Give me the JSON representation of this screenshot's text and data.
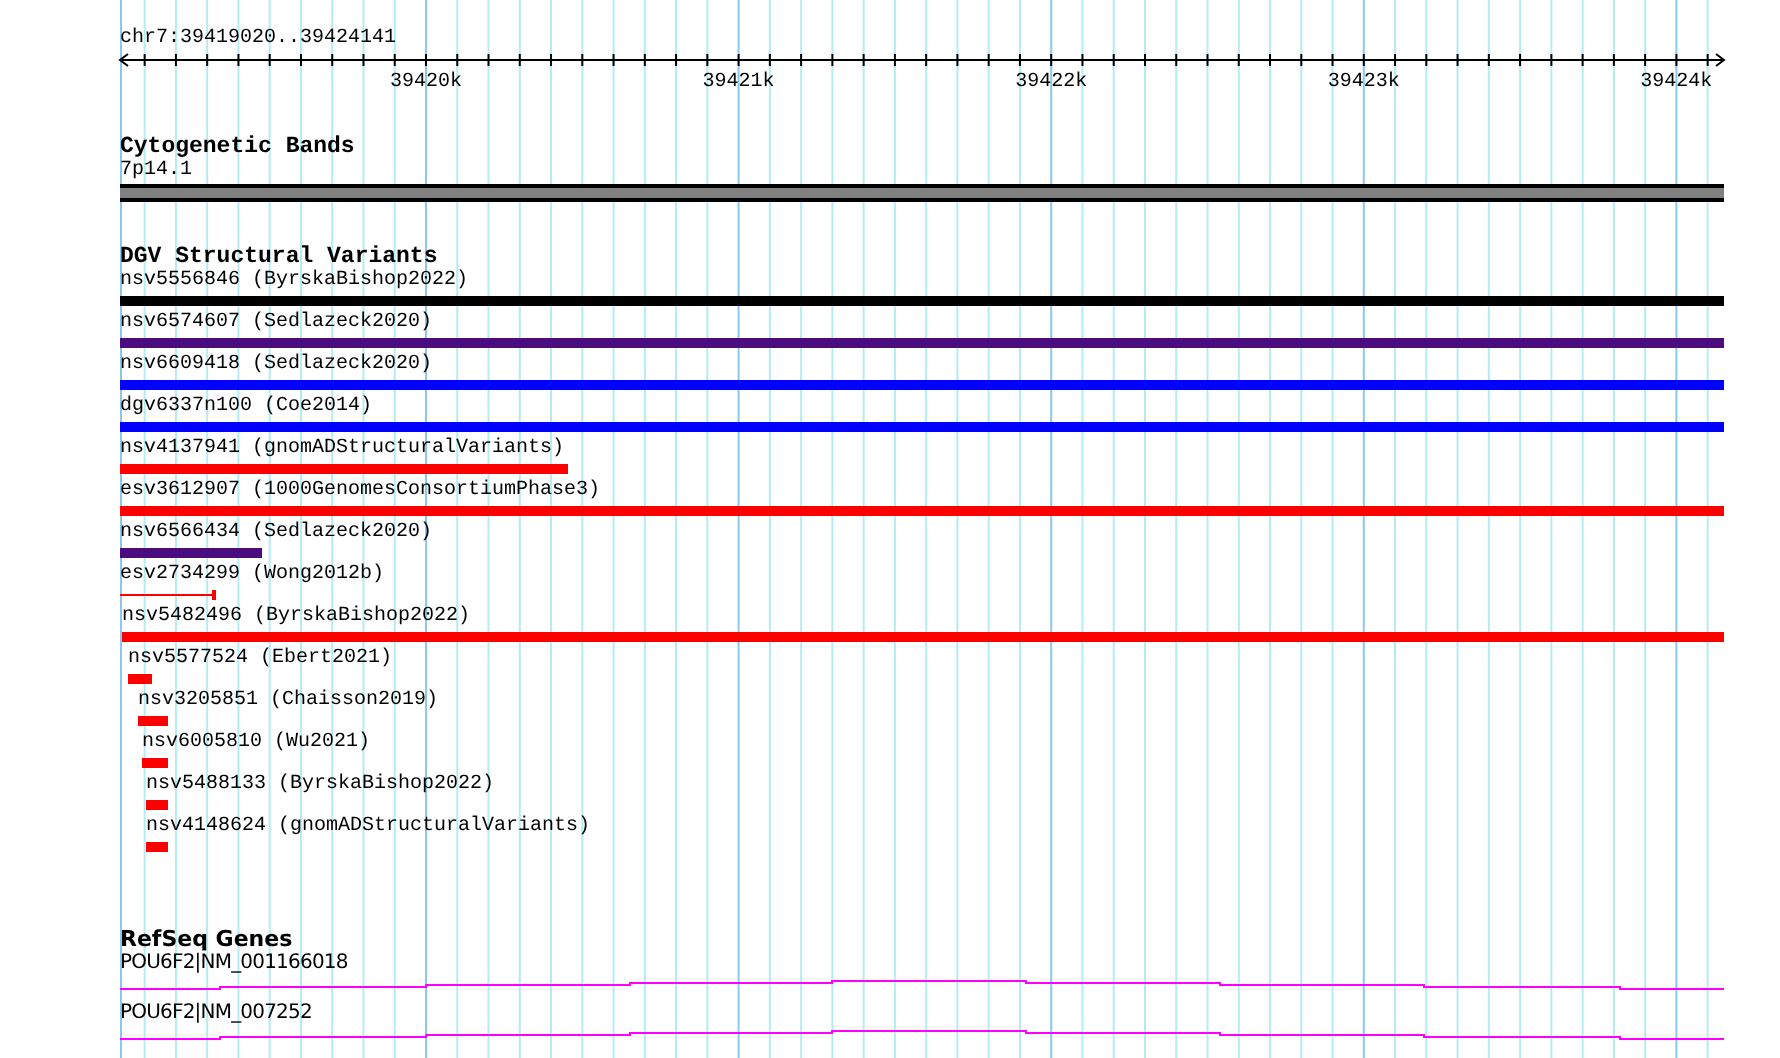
{
  "ruler": {
    "region": "chr7:39419020..39424141",
    "ticks": [
      "39420k",
      "39421k",
      "39422k",
      "39423k",
      "39424k"
    ]
  },
  "tracks": [
    {
      "kind": "cytoband",
      "title": "Cytogenetic Bands",
      "features": [
        {
          "label": "7p14.1"
        }
      ]
    },
    {
      "kind": "variants",
      "title": "DGV Structural Variants",
      "features": [
        {
          "label": "nsv5556846 (ByrskaBishop2022)",
          "kind": "bar",
          "color": "#000000"
        },
        {
          "label": "nsv6574607 (Sedlazeck2020)",
          "kind": "bar",
          "color": "#4b0c80"
        },
        {
          "label": "nsv6609418 (Sedlazeck2020)",
          "kind": "bar",
          "color": "#0000ff"
        },
        {
          "label": "dgv6337n100 (Coe2014)",
          "kind": "bar",
          "color": "#0000ff"
        },
        {
          "label": "nsv4137941 (gnomADStructuralVariants)",
          "kind": "bar",
          "color": "#ff0000"
        },
        {
          "label": "esv3612907 (1000GenomesConsortiumPhase3)",
          "kind": "bar",
          "color": "#ff0000"
        },
        {
          "label": "nsv6566434 (Sedlazeck2020)",
          "kind": "bar",
          "color": "#4b0c80"
        },
        {
          "label": "esv2734299 (Wong2012b)",
          "kind": "line",
          "color": "#ff0000"
        },
        {
          "label": "nsv5482496 (ByrskaBishop2022)",
          "kind": "bar",
          "color": "#ff0000"
        },
        {
          "label": "nsv5577524 (Ebert2021)",
          "kind": "bar",
          "color": "#ff0000"
        },
        {
          "label": "nsv3205851 (Chaisson2019)",
          "kind": "bar",
          "color": "#ff0000"
        },
        {
          "label": "nsv6005810 (Wu2021)",
          "kind": "bar",
          "color": "#ff0000"
        },
        {
          "label": "nsv5488133 (ByrskaBishop2022)",
          "kind": "bar",
          "color": "#ff0000"
        },
        {
          "label": "nsv4148624 (gnomADStructuralVariants)",
          "kind": "bar",
          "color": "#ff0000"
        }
      ]
    },
    {
      "kind": "genes",
      "title": "RefSeq Genes",
      "features": [
        {
          "label": "POU6F2|NM_001166018"
        },
        {
          "label": "POU6F2|NM_007252"
        }
      ]
    }
  ]
}
